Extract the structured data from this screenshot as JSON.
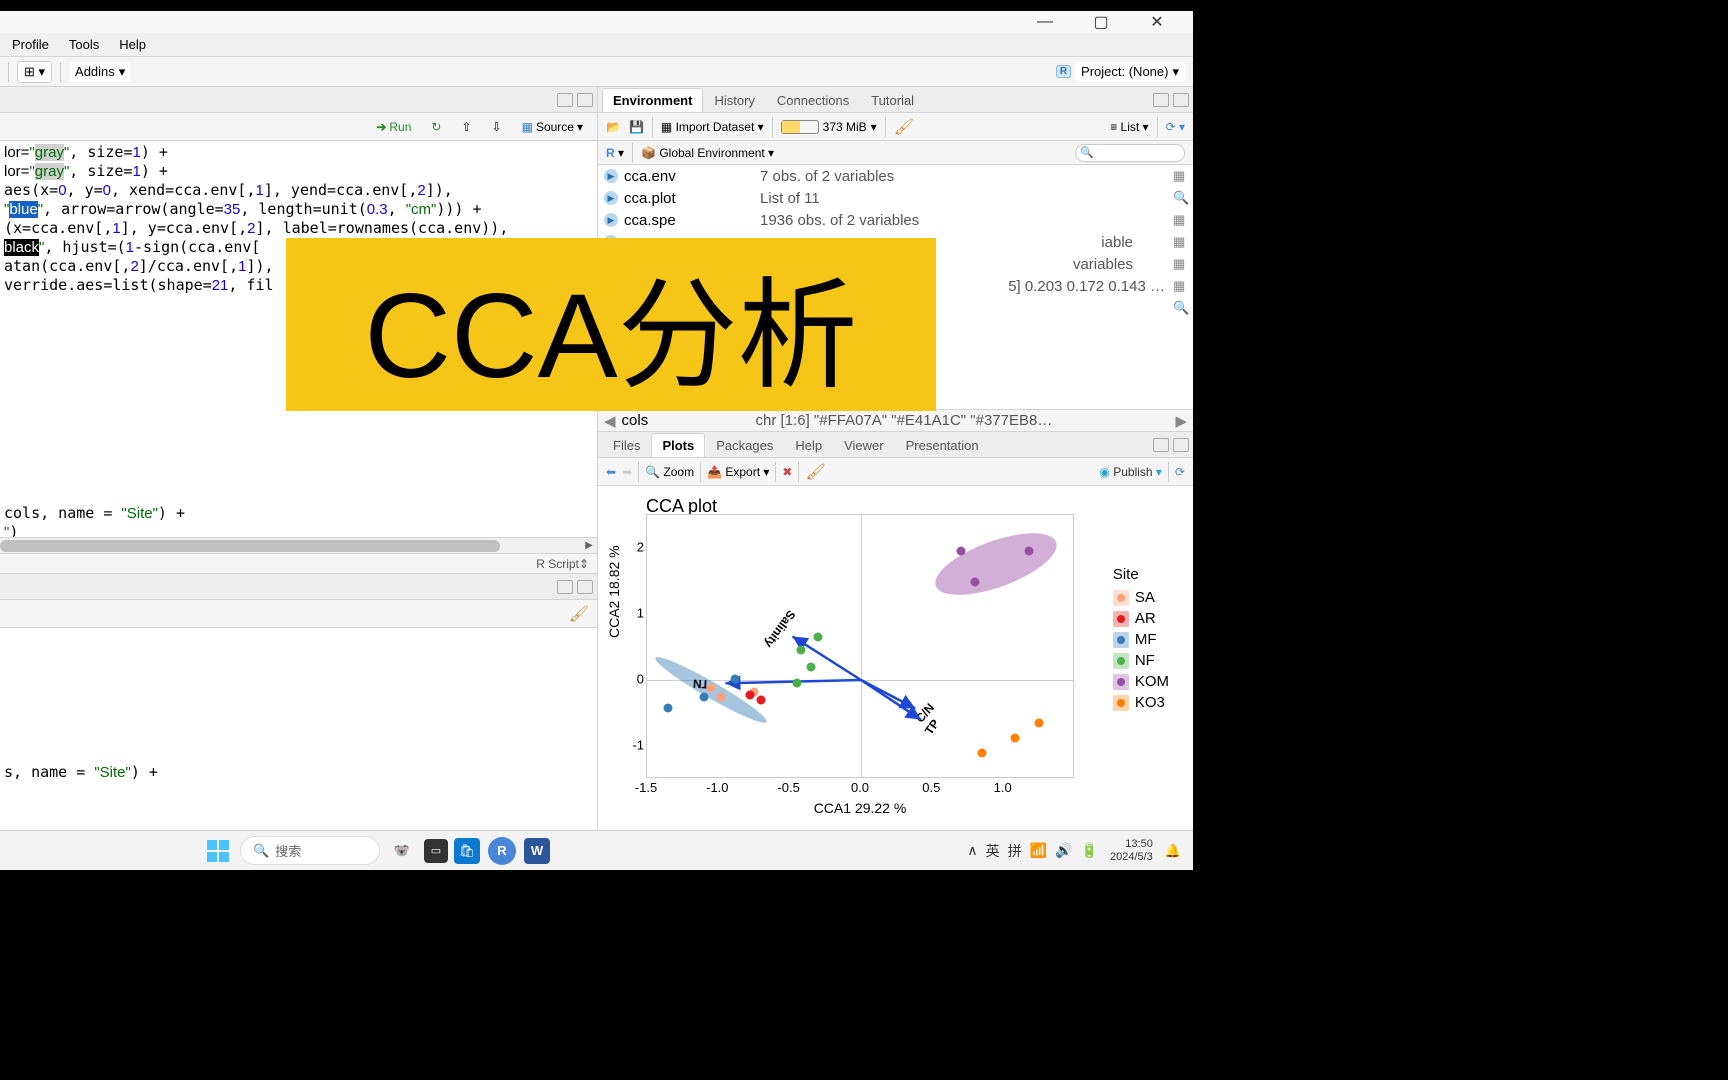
{
  "overlay": {
    "text": "CCA分析"
  },
  "titlebar": {},
  "menubar": {
    "profile": "Profile",
    "tools": "Tools",
    "help": "Help"
  },
  "toolbar": {
    "addins": "Addins",
    "project": "Project: (None)"
  },
  "source": {
    "run": "Run",
    "source_btn": "Source",
    "status": "R Script",
    "code_lines": [
      "lor=\"gray\", size=1) +",
      "lor=\"gray\", size=1) +",
      "aes(x=0, y=0, xend=cca.env[,1], yend=cca.env[,2]),",
      "\"blue\", arrow=arrow(angle=35, length=unit(0.3, \"cm\"))) +",
      "(x=cca.env[,1], y=cca.env[,2], label=rownames(cca.env)),",
      "black\", hjust=(1-sign(cca.env[",
      "atan(cca.env[,2]/cca.env[,1]),",
      "verride.aes=list(shape=21, fil",
      "",
      "",
      "cols, name = \"Site\") +",
      "\")"
    ],
    "console_line": "s, name = \"Site\") +"
  },
  "env": {
    "tabs": [
      "Environment",
      "History",
      "Connections",
      "Tutorial"
    ],
    "import": "Import Dataset",
    "mem": "373 MiB",
    "list": "List",
    "scope_r": "R",
    "scope_global": "Global Environment",
    "rows": [
      {
        "name": "cca.env",
        "val": "7 obs. of 2 variables",
        "act": "grid"
      },
      {
        "name": "cca.plot",
        "val": "List of  11",
        "act": "search"
      },
      {
        "name": "cca.spe",
        "val": "1936 obs. of 2 variables",
        "act": "grid"
      },
      {
        "name": "",
        "val": "iable",
        "act": "grid"
      },
      {
        "name": "",
        "val": "variables",
        "act": "grid"
      },
      {
        "name": "",
        "val": "5] 0.203 0.172 0.143 …",
        "act": "grid"
      },
      {
        "name": "",
        "val": "",
        "act": "search"
      }
    ],
    "footer_name": "cols",
    "footer_val": "chr [1:6] \"#FFA07A\" \"#E41A1C\" \"#377EB8…"
  },
  "plot": {
    "tabs": [
      "Files",
      "Plots",
      "Packages",
      "Help",
      "Viewer",
      "Presentation"
    ],
    "zoom": "Zoom",
    "export": "Export",
    "publish": "Publish"
  },
  "chart_data": {
    "type": "scatter",
    "title": "CCA plot",
    "xlabel": "CCA1 29.22 %",
    "ylabel": "CCA2 18.82 %",
    "xlim": [
      -1.5,
      1.5
    ],
    "ylim": [
      -1.5,
      2.5
    ],
    "x_ticks": [
      -1.5,
      -1.0,
      -0.5,
      0.0,
      0.5,
      1.0
    ],
    "y_ticks": [
      -1,
      0,
      1,
      2
    ],
    "legend_title": "Site",
    "legend": [
      {
        "name": "SA",
        "color": "#FFA07A"
      },
      {
        "name": "AR",
        "color": "#E41A1C"
      },
      {
        "name": "MF",
        "color": "#377EB8"
      },
      {
        "name": "NF",
        "color": "#4DAF4A"
      },
      {
        "name": "KOM",
        "color": "#984EA3"
      },
      {
        "name": "KO3",
        "color": "#FF7F00"
      }
    ],
    "arrows": [
      {
        "label": "Salinity",
        "x": -0.48,
        "y": 0.66
      },
      {
        "label": "TN",
        "x": -0.95,
        "y": -0.05
      },
      {
        "label": "C/N",
        "x": 0.38,
        "y": -0.43
      },
      {
        "label": "TP",
        "x": 0.42,
        "y": -0.6
      }
    ],
    "points": [
      {
        "site": "NF",
        "x": -0.3,
        "y": 0.65
      },
      {
        "site": "NF",
        "x": -0.42,
        "y": 0.45
      },
      {
        "site": "NF",
        "x": -0.35,
        "y": 0.2
      },
      {
        "site": "NF",
        "x": -0.45,
        "y": -0.05
      },
      {
        "site": "MF",
        "x": -0.88,
        "y": 0.02
      },
      {
        "site": "MF",
        "x": -1.1,
        "y": -0.25
      },
      {
        "site": "MF",
        "x": -1.35,
        "y": -0.42
      },
      {
        "site": "SA",
        "x": -0.98,
        "y": -0.25
      },
      {
        "site": "SA",
        "x": -1.05,
        "y": -0.12
      },
      {
        "site": "SA",
        "x": -0.75,
        "y": -0.18
      },
      {
        "site": "AR",
        "x": -0.78,
        "y": -0.22
      },
      {
        "site": "AR",
        "x": -0.7,
        "y": -0.3
      },
      {
        "site": "KOM",
        "x": 0.7,
        "y": 1.95
      },
      {
        "site": "KOM",
        "x": 1.18,
        "y": 1.95
      },
      {
        "site": "KOM",
        "x": 0.8,
        "y": 1.48
      },
      {
        "site": "KO3",
        "x": 1.25,
        "y": -0.65
      },
      {
        "site": "KO3",
        "x": 1.08,
        "y": -0.88
      },
      {
        "site": "KO3",
        "x": 0.85,
        "y": -1.1
      }
    ],
    "ellipses": [
      {
        "site": "KOM",
        "cx": 0.95,
        "cy": 1.75,
        "rx": 0.45,
        "ry": 0.35,
        "angle": -20
      },
      {
        "site": "MF",
        "cx": -1.05,
        "cy": -0.15,
        "rx": 0.45,
        "ry": 0.12,
        "angle": 30
      }
    ]
  },
  "taskbar": {
    "search": "搜索",
    "ime_up": "∧",
    "ime_lang": "英",
    "ime_pin": "拼",
    "time": "13:50",
    "date": "2024/5/3"
  }
}
